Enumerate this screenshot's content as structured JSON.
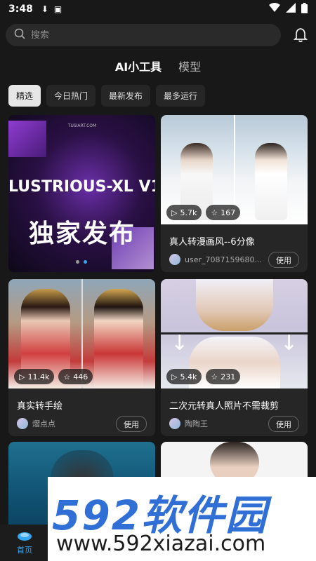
{
  "status": {
    "time": "3:48"
  },
  "search": {
    "placeholder": "搜索"
  },
  "tabs": [
    {
      "label": "AI小工具"
    },
    {
      "label": "模型"
    }
  ],
  "filters": [
    {
      "label": "精选"
    },
    {
      "label": "今日热门"
    },
    {
      "label": "最新发布"
    },
    {
      "label": "最多运行"
    }
  ],
  "banner": {
    "line1": "LUSTRIOUS-XL V1",
    "line2": "独家发布",
    "small": "TUSIART.COM"
  },
  "cards": [
    {
      "title": "真人转漫画风--6分像",
      "views": "5.7k",
      "stars": "167",
      "author": "user_7087159680...",
      "use_label": "使用"
    },
    {
      "title": "真实转手绘",
      "views": "11.4k",
      "stars": "446",
      "author": "熠点点",
      "use_label": "使用"
    },
    {
      "title": "二次元转真人照片不需裁剪",
      "views": "5.4k",
      "stars": "231",
      "author": "陶陶王",
      "use_label": "使用"
    }
  ],
  "nav": {
    "home_label": "首页"
  },
  "watermark": {
    "line1": "592软件园",
    "line2": "www.592xiazai.com"
  },
  "colors": {
    "accent": "#35a7f0",
    "background": "#181818",
    "card": "#262626",
    "watermark_blue": "#2f6fd6"
  }
}
